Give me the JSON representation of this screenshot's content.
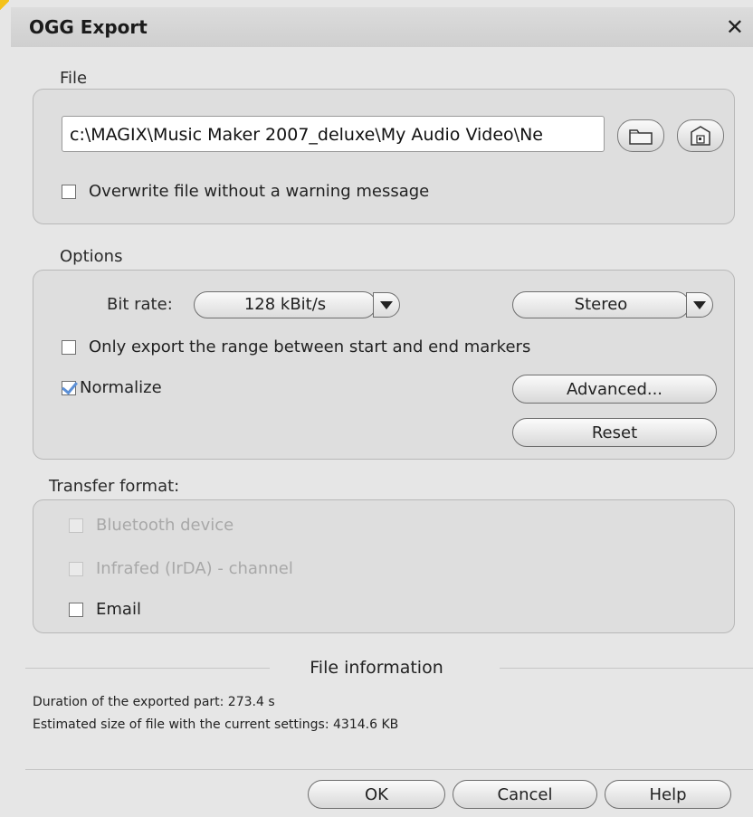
{
  "dialog": {
    "title": "OGG Export",
    "close_icon": "close-icon"
  },
  "file_section": {
    "label": "File",
    "path_value": "c:\\MAGIX\\Music Maker 2007_deluxe\\My Audio Video\\Ne",
    "browse_icon": "folder-icon",
    "save_icon": "save-drive-icon",
    "overwrite_label": "Overwrite file without a warning message",
    "overwrite_checked": false
  },
  "options_section": {
    "label": "Options",
    "bitrate_label": "Bit rate:",
    "bitrate_value": "128 kBit/s",
    "channel_value": "Stereo",
    "range_label": "Only export the range between start and end markers",
    "range_checked": false,
    "normalize_label": "Normalize",
    "normalize_checked": true,
    "advanced_label": "Advanced...",
    "reset_label": "Reset"
  },
  "transfer_section": {
    "label": "Transfer format:",
    "items": [
      {
        "label": "Bluetooth device",
        "enabled": false,
        "checked": false
      },
      {
        "label": "Infrafed (IrDA) - channel",
        "enabled": false,
        "checked": false
      },
      {
        "label": "Email",
        "enabled": true,
        "checked": false
      }
    ]
  },
  "file_info": {
    "title": "File information",
    "duration_line": "Duration of the exported part:  273.4 s",
    "size_line": "Estimated size of file with the current settings: 4314.6 KB"
  },
  "buttons": {
    "ok": "OK",
    "cancel": "Cancel",
    "help": "Help"
  }
}
